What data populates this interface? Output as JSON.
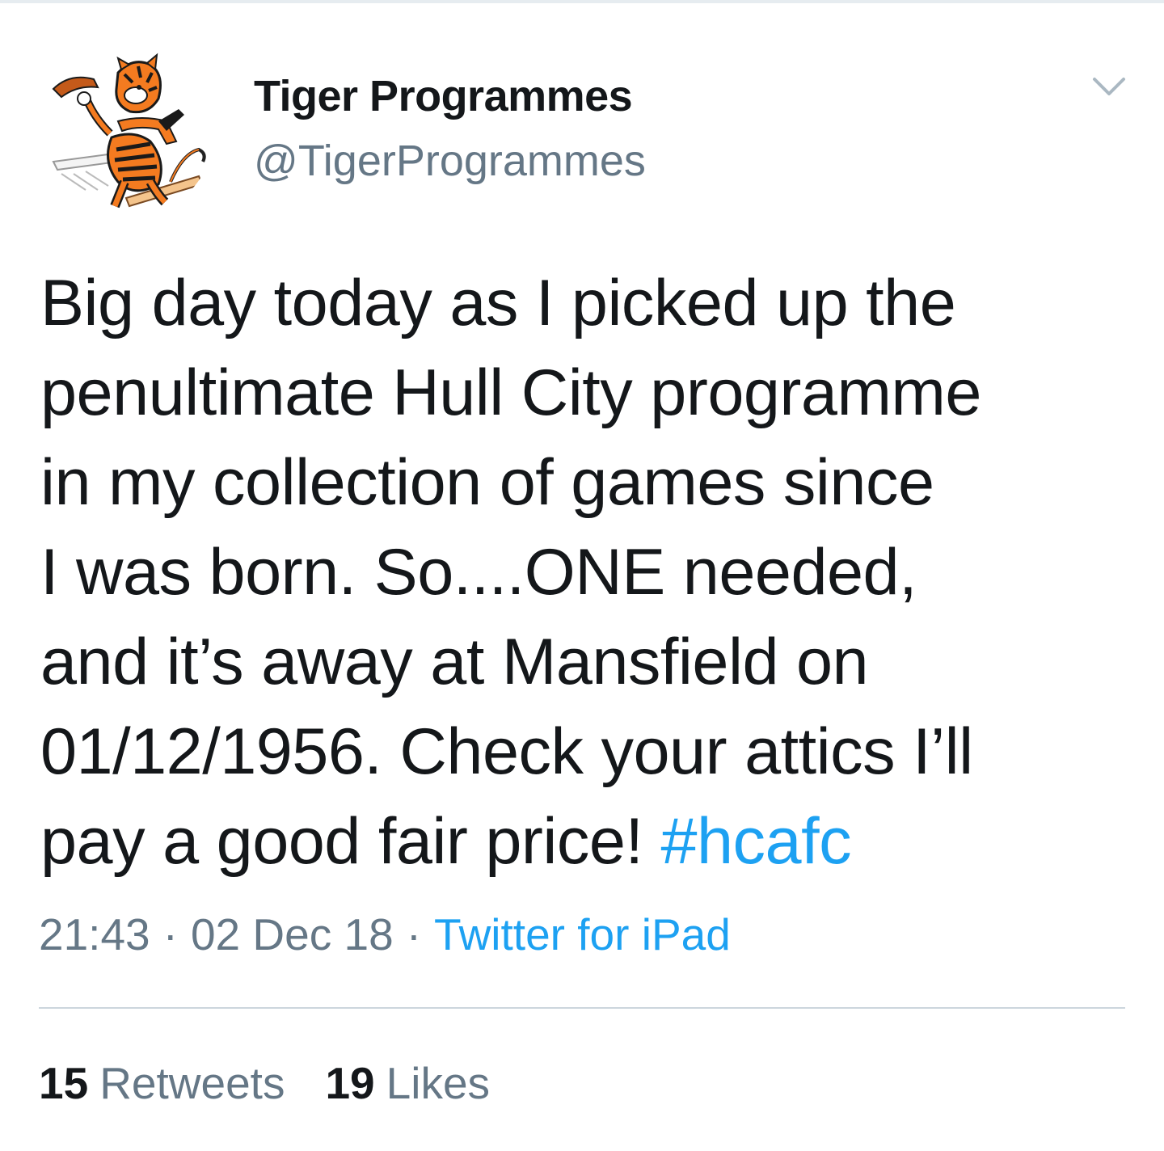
{
  "tweet": {
    "author": {
      "display_name": "Tiger Programmes",
      "handle": "@TigerProgrammes",
      "avatar_icon": "tiger-mascot-avatar"
    },
    "menu_icon": "chevron-down-icon",
    "text_lines": [
      "Big day today as I picked up the",
      "penultimate Hull City programme",
      "in my collection of games since",
      "I was born. So....ONE needed,",
      "and it’s away at Mansfield on",
      "01/12/1956. Check your attics I’ll",
      "pay a good fair price! "
    ],
    "hashtag": "#hcafc",
    "time": "21:43",
    "date": "02 Dec 18",
    "separator": "·",
    "source": "Twitter for iPad",
    "retweets": {
      "count": "15",
      "label": "Retweets"
    },
    "likes": {
      "count": "19",
      "label": "Likes"
    }
  },
  "colors": {
    "text": "#14171a",
    "secondary": "#657786",
    "link": "#1da1f2",
    "divider": "#ccd6dd",
    "tiger_orange": "#f47b20"
  }
}
